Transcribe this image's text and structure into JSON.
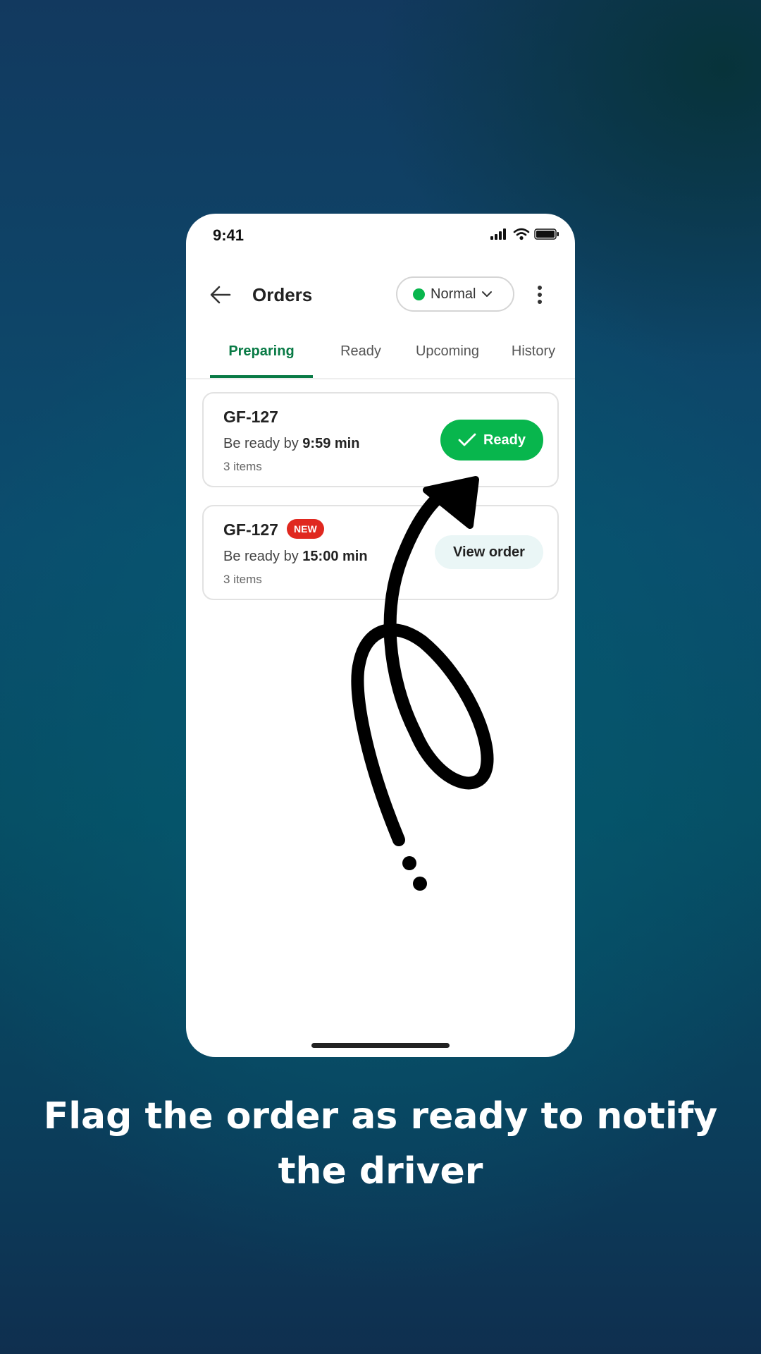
{
  "status_bar": {
    "time": "9:41",
    "icons": [
      "signal-icon",
      "wifi-icon",
      "battery-icon"
    ]
  },
  "header": {
    "title": "Orders",
    "mode_label": "Normal",
    "mode_status_color": "#08b64d"
  },
  "tabs": [
    {
      "label": "Preparing",
      "active": true
    },
    {
      "label": "Ready",
      "active": false
    },
    {
      "label": "Upcoming",
      "active": false
    },
    {
      "label": "History",
      "active": false
    }
  ],
  "orders": [
    {
      "id": "GF-127",
      "eta_prefix": "Be ready by",
      "eta_value": "9:59 min",
      "items": "3 items",
      "badge": "",
      "action_label": "Ready"
    },
    {
      "id": "GF-127",
      "eta_prefix": "Be ready by",
      "eta_value": "15:00 min",
      "items": "3 items",
      "badge": "NEW",
      "action_label": "View order"
    }
  ],
  "caption": "Flag the order as ready to notify the driver",
  "colors": {
    "accent_green": "#08b64d",
    "tab_active": "#087a45",
    "badge_red": "#e0281f"
  }
}
